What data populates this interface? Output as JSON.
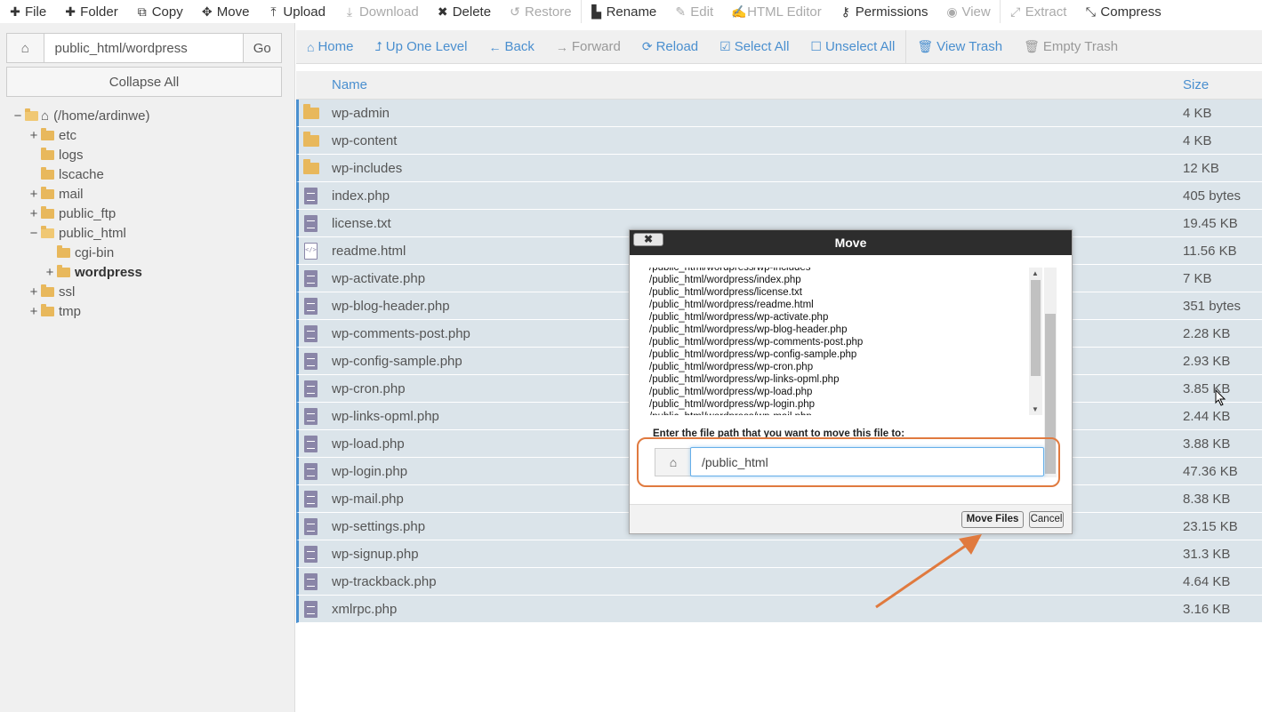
{
  "toolbar": {
    "items": [
      {
        "label": "File",
        "icon": "plus-icon",
        "disabled": false
      },
      {
        "label": "Folder",
        "icon": "plus-icon",
        "disabled": false
      },
      {
        "label": "Copy",
        "icon": "copy-icon",
        "disabled": false
      },
      {
        "label": "Move",
        "icon": "move-icon",
        "disabled": false
      },
      {
        "label": "Upload",
        "icon": "upload-icon",
        "disabled": false
      },
      {
        "label": "Download",
        "icon": "download-icon",
        "disabled": true
      },
      {
        "label": "Delete",
        "icon": "close-icon",
        "disabled": false
      },
      {
        "label": "Restore",
        "icon": "restore-icon",
        "disabled": true
      },
      {
        "label": "Rename",
        "icon": "file-icon",
        "disabled": false
      },
      {
        "label": "Edit",
        "icon": "pencil-icon",
        "disabled": true
      },
      {
        "label": "HTML Editor",
        "icon": "edit-icon",
        "disabled": true
      },
      {
        "label": "Permissions",
        "icon": "key-icon",
        "disabled": false
      },
      {
        "label": "View",
        "icon": "eye-icon",
        "disabled": true
      },
      {
        "label": "Extract",
        "icon": "expand-icon",
        "disabled": true
      },
      {
        "label": "Compress",
        "icon": "compress-icon",
        "disabled": false
      }
    ]
  },
  "sidebar": {
    "path_value": "public_html/wordpress",
    "go_label": "Go",
    "collapse_label": "Collapse All",
    "tree": [
      {
        "label": "(/home/ardinwe)",
        "toggle": "−",
        "indent": 0,
        "icon": "home-icon",
        "bold": false
      },
      {
        "label": "etc",
        "toggle": "+",
        "indent": 1,
        "icon": "folder-icon",
        "bold": false
      },
      {
        "label": "logs",
        "toggle": "",
        "indent": 1,
        "icon": "folder-icon",
        "bold": false
      },
      {
        "label": "lscache",
        "toggle": "",
        "indent": 1,
        "icon": "folder-icon",
        "bold": false
      },
      {
        "label": "mail",
        "toggle": "+",
        "indent": 1,
        "icon": "folder-icon",
        "bold": false
      },
      {
        "label": "public_ftp",
        "toggle": "+",
        "indent": 1,
        "icon": "folder-icon",
        "bold": false
      },
      {
        "label": "public_html",
        "toggle": "−",
        "indent": 1,
        "icon": "folder-open-icon",
        "bold": false
      },
      {
        "label": "cgi-bin",
        "toggle": "",
        "indent": 2,
        "icon": "folder-icon",
        "bold": false
      },
      {
        "label": "wordpress",
        "toggle": "+",
        "indent": 2,
        "icon": "folder-icon",
        "bold": true
      },
      {
        "label": "ssl",
        "toggle": "+",
        "indent": 1,
        "icon": "folder-icon",
        "bold": false
      },
      {
        "label": "tmp",
        "toggle": "+",
        "indent": 1,
        "icon": "folder-icon",
        "bold": false
      }
    ]
  },
  "nav": {
    "items": [
      {
        "label": "Home",
        "icon": "home-icon",
        "disabled": false
      },
      {
        "label": "Up One Level",
        "icon": "level-up-icon",
        "disabled": false
      },
      {
        "label": "Back",
        "icon": "arrow-left-icon",
        "disabled": false
      },
      {
        "label": "Forward",
        "icon": "arrow-right-icon",
        "disabled": true
      },
      {
        "label": "Reload",
        "icon": "reload-icon",
        "disabled": false
      },
      {
        "label": "Select All",
        "icon": "check-square-icon",
        "disabled": false
      },
      {
        "label": "Unselect All",
        "icon": "square-icon",
        "disabled": false
      },
      {
        "label": "View Trash",
        "icon": "trash-icon",
        "disabled": false
      },
      {
        "label": "Empty Trash",
        "icon": "trash-icon",
        "disabled": true
      }
    ]
  },
  "list": {
    "col_name": "Name",
    "col_size": "Size",
    "rows": [
      {
        "name": "wp-admin",
        "size": "4 KB",
        "type": "folder"
      },
      {
        "name": "wp-content",
        "size": "4 KB",
        "type": "folder"
      },
      {
        "name": "wp-includes",
        "size": "12 KB",
        "type": "folder"
      },
      {
        "name": "index.php",
        "size": "405 bytes",
        "type": "file"
      },
      {
        "name": "license.txt",
        "size": "19.45 KB",
        "type": "file"
      },
      {
        "name": "readme.html",
        "size": "11.56 KB",
        "type": "code"
      },
      {
        "name": "wp-activate.php",
        "size": "7 KB",
        "type": "file"
      },
      {
        "name": "wp-blog-header.php",
        "size": "351 bytes",
        "type": "file"
      },
      {
        "name": "wp-comments-post.php",
        "size": "2.28 KB",
        "type": "file"
      },
      {
        "name": "wp-config-sample.php",
        "size": "2.93 KB",
        "type": "file"
      },
      {
        "name": "wp-cron.php",
        "size": "3.85 KB",
        "type": "file"
      },
      {
        "name": "wp-links-opml.php",
        "size": "2.44 KB",
        "type": "file"
      },
      {
        "name": "wp-load.php",
        "size": "3.88 KB",
        "type": "file"
      },
      {
        "name": "wp-login.php",
        "size": "47.36 KB",
        "type": "file"
      },
      {
        "name": "wp-mail.php",
        "size": "8.38 KB",
        "type": "file"
      },
      {
        "name": "wp-settings.php",
        "size": "23.15 KB",
        "type": "file"
      },
      {
        "name": "wp-signup.php",
        "size": "31.3 KB",
        "type": "file"
      },
      {
        "name": "wp-trackback.php",
        "size": "4.64 KB",
        "type": "file"
      },
      {
        "name": "xmlrpc.php",
        "size": "3.16 KB",
        "type": "file"
      }
    ]
  },
  "modal": {
    "title": "Move",
    "close_label": "✖",
    "files": [
      "/public_html/wordpress/wp-includes",
      "/public_html/wordpress/index.php",
      "/public_html/wordpress/license.txt",
      "/public_html/wordpress/readme.html",
      "/public_html/wordpress/wp-activate.php",
      "/public_html/wordpress/wp-blog-header.php",
      "/public_html/wordpress/wp-comments-post.php",
      "/public_html/wordpress/wp-config-sample.php",
      "/public_html/wordpress/wp-cron.php",
      "/public_html/wordpress/wp-links-opml.php",
      "/public_html/wordpress/wp-load.php",
      "/public_html/wordpress/wp-login.php",
      "/public_html/wordpress/wp-mail.php"
    ],
    "prompt": "Enter the file path that you want to move this file to:",
    "dest_value": "/public_html",
    "move_label": "Move Files",
    "cancel_label": "Cancel"
  },
  "colors": {
    "accent": "#4a8fcf",
    "selected_row": "#dbe4ea",
    "highlight": "#e07a3f",
    "folder": "#e8b85c",
    "file": "#8a86a8"
  }
}
